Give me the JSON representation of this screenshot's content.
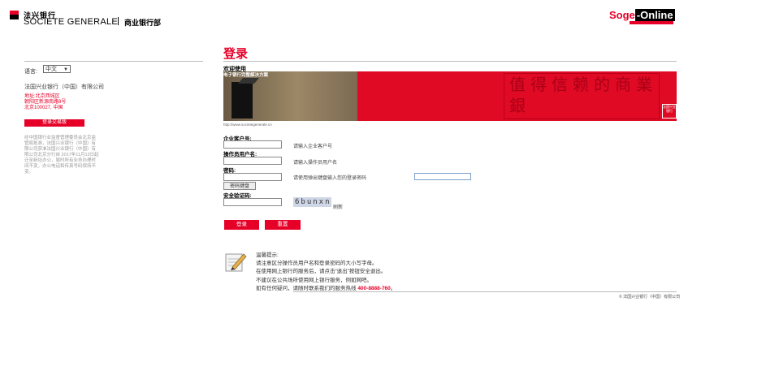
{
  "header": {
    "logo_cn": "法兴银行",
    "logo_en": "SOCIETE GENERALE",
    "division": "商业银行部",
    "brand_left": "Soge",
    "brand_right": "Online",
    "brand_sep": "-"
  },
  "left": {
    "language_label": "语言:",
    "language_value": "中文",
    "bank_name": "法国兴业银行（中国）有限公司",
    "address": [
      "地址:北京西城区",
      "朝阳区新源南路8号",
      "北京100027, 中国"
    ],
    "trade_button": "登录交易版",
    "notice": "经中国银行业监督管理委员会北京监管局批准，法国兴业银行（中国）有限公司获准法国兴业银行（中国）有限公司北京分行自 2017年11月13日起迁至新址办公，届时所有业务办理时间不变，办公电话和传真号码保持不变。"
  },
  "main": {
    "title": "登录",
    "welcome": "欢迎使用",
    "banner_tag": "电子银行完整解决方案",
    "banner_seal": "值得信赖的商業銀",
    "banner_stamp": "法国兴业银行",
    "url": "http://www.societegenerale.cn"
  },
  "form": {
    "customer_label": "企业客户号:",
    "customer_hint": "请输入企业客户号",
    "operator_label": "操作员用户名:",
    "operator_hint": "请输入操作员用户名",
    "password_label": "密码:",
    "password_hint": "请使用弹出键盘输入您的登录密码",
    "keyboard_button": "密码键盘",
    "captcha_label": "安全验证码:",
    "captcha_text": "6bunxn",
    "refresh_label": "刷新",
    "login_button": "登录",
    "reset_button": "重置"
  },
  "tips": {
    "title": "温馨提示:",
    "lines": [
      "请注意区分操作员用户名和登录密码的大小写字母。",
      "在使用网上银行的服务后，请点击“退出”按钮安全退出。",
      "不建议在公共场所使用网上银行服务，例如网吧。"
    ],
    "hotline_prefix": "如有任何疑问，请随时联系我们的服务热线 ",
    "hotline": "400-8888-760",
    "hotline_suffix": "。"
  },
  "footer": {
    "copyright": "©  法国兴业银行（中国）有限公司"
  },
  "colors": {
    "accent": "#e60028",
    "captcha_bg": "#cfd6e6",
    "input_focus_border": "#7a9ec9"
  }
}
